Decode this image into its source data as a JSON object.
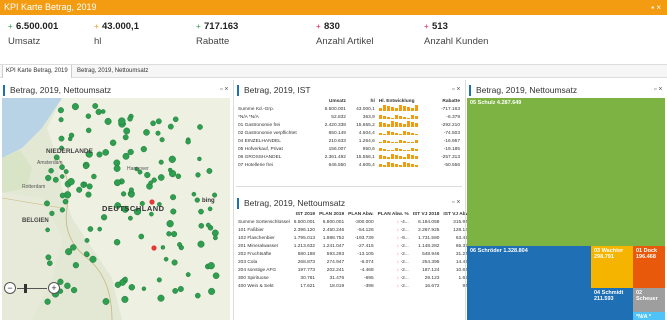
{
  "window": {
    "title": "KPI Karte Betrag, 2019",
    "controls": "▪ ×"
  },
  "kpis": [
    {
      "value": "6.500.001",
      "label": "Umsatz",
      "arrow": "+",
      "color": "#2e9e4f"
    },
    {
      "value": "43.000,1",
      "label": "hl",
      "arrow": "+",
      "color": "#f39c12"
    },
    {
      "value": "717.163",
      "label": "Rabatte",
      "arrow": "+",
      "color": "#2e9e4f"
    },
    {
      "value": "830",
      "label": "Anzahl Artikel",
      "arrow": "+",
      "color": "#e91e63"
    },
    {
      "value": "513",
      "label": "Anzahl Kunden",
      "arrow": "+",
      "color": "#e91e63"
    }
  ],
  "tabs": [
    "KPI Karte Betrag, 2019",
    "Betrag, 2019, Nettoumsatz"
  ],
  "map_panel": {
    "title": "Betrag, 2019, Nettoumsatz",
    "controls": "▫ ×",
    "bing": "bing",
    "places": [
      "NIEDERLANDE",
      "DEUTSCHLAND",
      "BELGIEN",
      "Amsterdam",
      "Hannover",
      "Rotterdam"
    ],
    "zoom_minus": "−",
    "zoom_plus": "+"
  },
  "ist_panel": {
    "title": "Betrag, 2019, IST",
    "controls": "▫ ×",
    "headers": [
      "",
      "Umsatz",
      "hl",
      "Hl. Entwicklung",
      "Rabatte"
    ],
    "rows": [
      [
        "Summe Kd.-Grp.",
        "6.500.001",
        "43.000,1",
        "",
        "-717.163"
      ],
      [
        "*N/A *N/A",
        "52.832",
        "363,9",
        "",
        "-6.379"
      ],
      [
        "01 Gastronomie frei",
        "2.420.338",
        "15.655,2",
        "",
        "-292.210"
      ],
      [
        "02 Gastronomie verpflichtet",
        "650.149",
        "4.504,4",
        "",
        "-74.503"
      ],
      [
        "04 EINZELHANDEL",
        "210.633",
        "1.264,6",
        "",
        "-16.957"
      ],
      [
        "05 Hofverkauf, Privat",
        "156.007",
        "950,6",
        "",
        "-19.185"
      ],
      [
        "06 GROSSHANDEL",
        "2.361.492",
        "15.556,1",
        "",
        "-257.313"
      ],
      [
        "07 Hotellerie frei",
        "646.550",
        "4.605,4",
        "",
        "-50.556"
      ]
    ]
  },
  "net_panel": {
    "title": "Betrag, 2019, Nettoumsatz",
    "controls": "▫ ×",
    "headers": [
      "",
      "IST 2019",
      "PLAN 2019",
      "PLAN Abw.",
      "PLAN Abw. %",
      "IST VJ 2018",
      "IST VJ Abw.",
      "IST VJ Abw. %"
    ],
    "rows": [
      [
        "Summe Sortenschlüssel",
        "6.500.001",
        "6.800.001",
        "-300.000",
        "-4...",
        "6.184.058",
        "315.943",
        "5.1%"
      ],
      [
        "101 Faßbier",
        "2.396.120",
        "2.450.246",
        "-54.126",
        "-2...",
        "2.267.925",
        "128.194",
        "5.7%"
      ],
      [
        "102 Flaschenbier",
        "1.795.013",
        "1.988.752",
        "-193.739",
        "-9...",
        "1.731.590",
        "63.423",
        "3.7%"
      ],
      [
        "201 Mineralwasser",
        "1.213.632",
        "1.241.047",
        "-27.415",
        "-2...",
        "1.148.282",
        "65.350",
        "5.7%"
      ],
      [
        "202 Fruchtsäfte",
        "580.188",
        "593.293",
        "-13.105",
        "-2...",
        "548.946",
        "31.242",
        "5.7%"
      ],
      [
        "203 Cola",
        "268.873",
        "274.947",
        "-6.074",
        "-2...",
        "254.395",
        "14.478",
        "5.7%"
      ],
      [
        "204 sonstige AFG",
        "197.773",
        "202.241",
        "-4.468",
        "-2...",
        "187.124",
        "10.649",
        "5.7%"
      ],
      [
        "300 Spirituose",
        "30.781",
        "31.476",
        "-695",
        "-2...",
        "29.123",
        "1.658",
        "5.7%"
      ],
      [
        "400 Wein & Sekt",
        "17.621",
        "18.019",
        "-398",
        "-2...",
        "16.672",
        "949",
        "5.7%"
      ]
    ]
  },
  "treemap_panel": {
    "title": "Betrag, 2019, Nettoumsatz",
    "controls": "▫ ×",
    "tiles": [
      {
        "label": "05 Schulz 4.287.649",
        "color": "#7cb342"
      },
      {
        "label": "06 Schröder 1.328.804",
        "color": "#1f6fb5"
      },
      {
        "label": "03 Wachter 298.791",
        "color": "#f4b400"
      },
      {
        "label": "01 Dock 196.468",
        "color": "#e8590c"
      },
      {
        "label": "04 Schmidt 211.593",
        "color": "#1f6fb5"
      },
      {
        "label": "02 Scheuer",
        "color": "#9e9e9e"
      },
      {
        "label": "*N/A *",
        "color": "#4fc3f7"
      }
    ]
  }
}
